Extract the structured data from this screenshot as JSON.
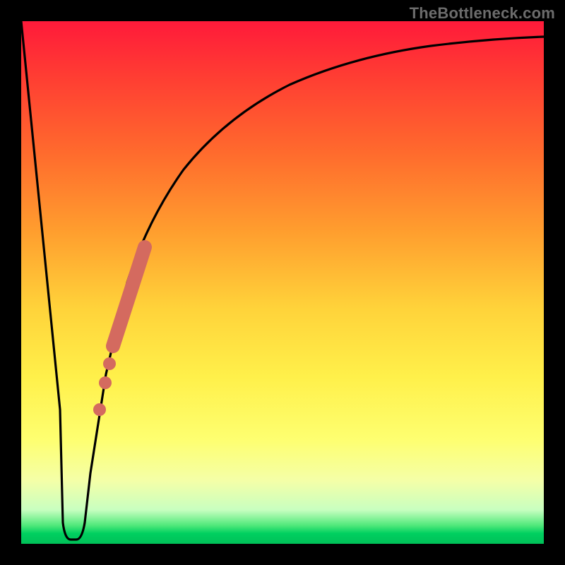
{
  "watermark": "TheBottleneck.com",
  "chart_data": {
    "type": "line",
    "title": "",
    "xlabel": "",
    "ylabel": "",
    "xlim": [
      0,
      100
    ],
    "ylim": [
      0,
      100
    ],
    "grid": false,
    "legend": false,
    "series": [
      {
        "name": "bottleneck-curve",
        "x": [
          0,
          2,
          4,
          6,
          7,
          7.5,
          8,
          8.5,
          9,
          10,
          12,
          14,
          16,
          18,
          20,
          23,
          26,
          30,
          35,
          40,
          46,
          55,
          65,
          78,
          90,
          100
        ],
        "y": [
          100,
          75,
          48,
          22,
          9,
          3,
          1,
          1,
          3,
          9,
          20,
          30,
          39,
          46,
          52,
          59,
          65,
          71,
          77,
          81,
          85,
          89,
          92,
          94.5,
          96,
          97
        ]
      }
    ],
    "highlight_segment": {
      "name": "thick-red-segment",
      "color": "#d46a5f",
      "x": [
        15.5,
        21.5
      ],
      "y": [
        36,
        55
      ]
    },
    "highlight_dots": {
      "name": "red-dots",
      "color": "#d46a5f",
      "points": [
        {
          "x": 14.8,
          "y": 33.5
        },
        {
          "x": 14.0,
          "y": 30.0
        },
        {
          "x": 12.9,
          "y": 25.0
        }
      ]
    }
  }
}
